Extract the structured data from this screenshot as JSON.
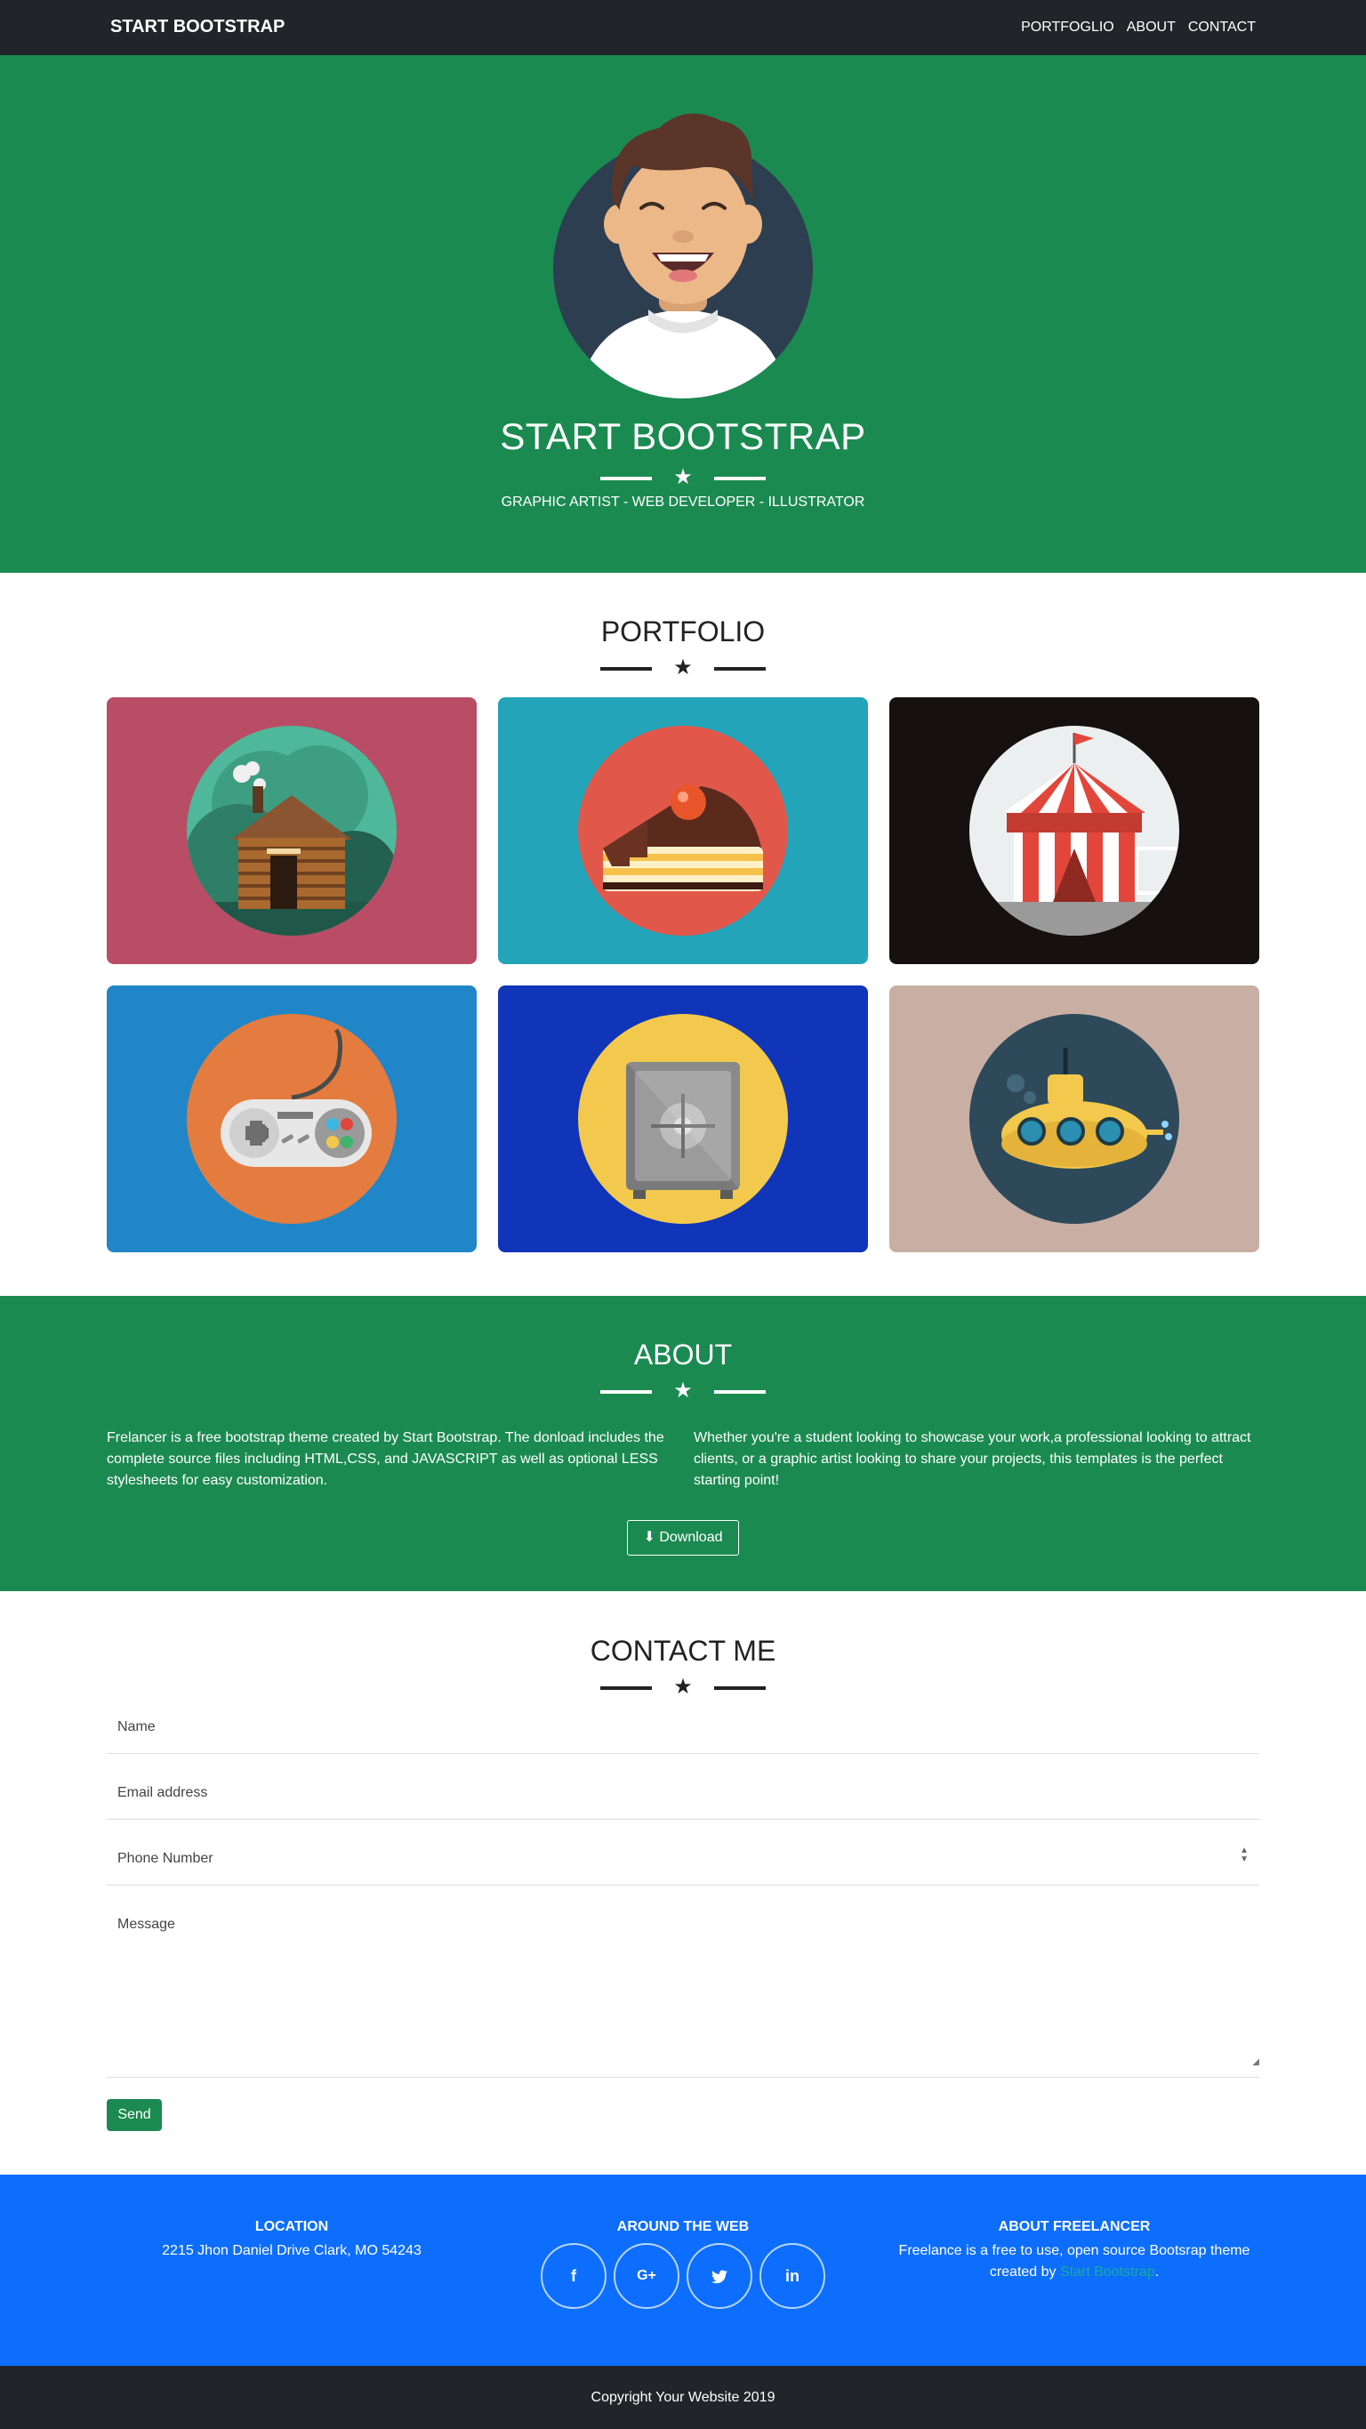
{
  "nav": {
    "brand": "START BOOTSTRAP",
    "links": [
      "PORTFOGLIO",
      "ABOUT",
      "CONTACT"
    ]
  },
  "hero": {
    "title": "START BOOTSTRAP",
    "tagline": "GRAPHIC ARTIST - WEB DEVELOPER - ILLUSTRATOR"
  },
  "portfolio": {
    "title": "PORTFOLIO",
    "items": [
      {
        "icon": "cabin-icon",
        "bg": "#b94d66"
      },
      {
        "icon": "cake-icon",
        "bg": "#23a4b8"
      },
      {
        "icon": "circus-tent-icon",
        "bg": "#161110"
      },
      {
        "icon": "game-controller-icon",
        "bg": "#2086c7"
      },
      {
        "icon": "safe-icon",
        "bg": "#1035b8"
      },
      {
        "icon": "submarine-icon",
        "bg": "#c9afa3"
      }
    ]
  },
  "about": {
    "title": "ABOUT",
    "left": "Frelancer is a free bootstrap theme created by Start Bootstrap. The donload includes the complete source files including HTML,CSS, and JAVASCRIPT as well as optional LESS stylesheets for easy customization.",
    "right": "Whether you're a student looking to showcase your work,a professional looking to attract clients, or a graphic artist looking to share your projects, this templates is the perfect starting point!",
    "download": "Download"
  },
  "contact": {
    "title": "CONTACT ME",
    "name": "Name",
    "email": "Email address",
    "phone": "Phone Number",
    "message": "Message",
    "send": "Send"
  },
  "footer": {
    "location_title": "LOCATION",
    "location_text": "2215 Jhon Daniel Drive Clark, MO 54243",
    "web_title": "AROUND THE WEB",
    "social": [
      "f",
      "G+",
      "twitter",
      "in"
    ],
    "about_title": "ABOUT FREELANCER",
    "about_text1": "Freelance is a free to use, open source Bootsrap theme",
    "about_text2": "created by",
    "about_link": "Start Bootstrap",
    "about_end": "."
  },
  "copyright": "Copyright Your Website 2019",
  "colors": {
    "green": "#1b8a51",
    "blue": "#0d6efd",
    "dark": "#212529"
  }
}
